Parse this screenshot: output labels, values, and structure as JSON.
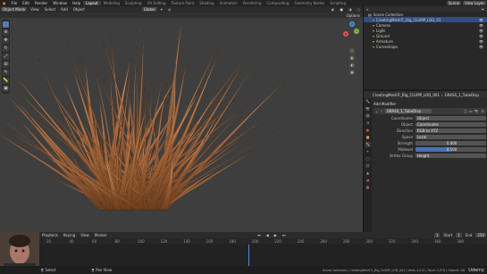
{
  "topbar": {
    "menus": [
      "File",
      "Edit",
      "Render",
      "Window",
      "Help"
    ],
    "workspaces": [
      "Layout",
      "Modeling",
      "Sculpting",
      "UV Editing",
      "Texture Paint",
      "Shading",
      "Animation",
      "Rendering",
      "Compositing",
      "Geometry Nodes",
      "Scripting"
    ],
    "active_workspace": "Layout",
    "scene": "Scene",
    "view_layer": "View Layer"
  },
  "viewport_header": {
    "mode": "Object Mode",
    "menus": [
      "View",
      "Select",
      "Add",
      "Object"
    ],
    "orientation": "Global",
    "options": "Options"
  },
  "outliner": {
    "title": "Scene Collection",
    "items": [
      {
        "label": "CreatingMeshTr_Big_CLUMP_LOD_01",
        "icon": "mesh-icon",
        "color": "#e7a84b"
      },
      {
        "label": "Camera",
        "icon": "camera-icon",
        "color": "#8dcc6f"
      },
      {
        "label": "Light",
        "icon": "light-icon",
        "color": "#8dcc6f"
      },
      {
        "label": "Ground",
        "icon": "mesh-icon",
        "color": "#e7a84b"
      },
      {
        "label": "Armature",
        "icon": "armature-icon",
        "color": "#8dcc6f"
      },
      {
        "label": "Curveshape",
        "icon": "curve-icon",
        "color": "#8dcc6f"
      }
    ]
  },
  "properties": {
    "breadcrumb": [
      "CreatingMeshTr_Big_CLUMP_LOD_001",
      "GRASS_1_TubeDisp"
    ],
    "modifier_section": "Add Modifier",
    "modifier_name": "GRASS_1_TubeDisp",
    "rows": [
      {
        "label": "Coordinates",
        "value": "Object"
      },
      {
        "label": "Object",
        "value": "Coordinates"
      },
      {
        "label": "Direction",
        "value": "RGB to XYZ"
      },
      {
        "label": "Space",
        "value": "Local"
      },
      {
        "label": "Strength",
        "value": "0.000"
      },
      {
        "label": "Midlevel",
        "value": "0.500"
      },
      {
        "label": "Vertex Group",
        "value": "Height"
      }
    ]
  },
  "timeline": {
    "menus": [
      "Playback",
      "Keying",
      "View",
      "Marker"
    ],
    "start": "1",
    "end": "250",
    "current_frame": "1",
    "ticks": [
      "20",
      "40",
      "60",
      "80",
      "100",
      "120",
      "140",
      "160",
      "180",
      "200",
      "220",
      "240",
      "260",
      "280",
      "300",
      "320",
      "340",
      "360",
      "380"
    ]
  },
  "statusbar": {
    "left": "Select",
    "middle": "Pan View",
    "right": "Scene Collection | CreatingMeshTr_Big_CLUMP_LOD_001 | Verts 4,213 | Faces 3,970 | Objects 1/6"
  },
  "watermark": "Udemy"
}
